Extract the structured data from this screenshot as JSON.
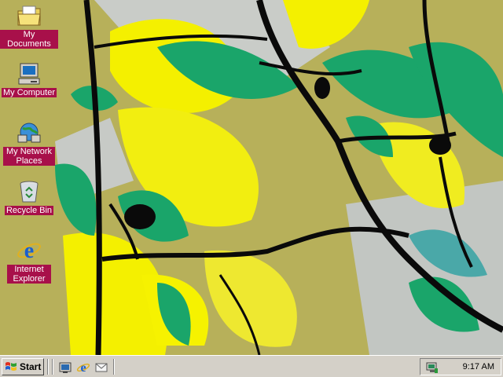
{
  "desktop": {
    "icons": [
      {
        "label": "My Documents",
        "icon": "folder-documents-icon"
      },
      {
        "label": "My Computer",
        "icon": "computer-icon"
      },
      {
        "label": "My Network Places",
        "icon": "network-places-icon"
      },
      {
        "label": "Recycle Bin",
        "icon": "recycle-bin-icon"
      },
      {
        "label": "Internet Explorer",
        "icon": "internet-explorer-icon"
      }
    ]
  },
  "taskbar": {
    "start_label": "Start",
    "quick_launch": [
      {
        "icon": "show-desktop-icon"
      },
      {
        "icon": "internet-explorer-icon"
      },
      {
        "icon": "outlook-express-icon"
      }
    ],
    "tray": {
      "clock": "9:17 AM",
      "icon": "display-settings-icon"
    }
  },
  "colors": {
    "taskbar": "#d4d0c8",
    "label_bg": "#a8104a",
    "wallpaper_yellow": "#f4f000",
    "wallpaper_green": "#1aa56a",
    "wallpaper_olive": "#b7b05a"
  }
}
